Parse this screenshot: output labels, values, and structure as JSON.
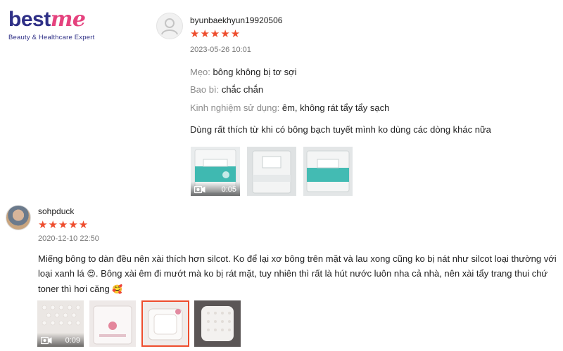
{
  "logo": {
    "word_best": "best",
    "word_me": "me",
    "tagline": "Beauty & Healthcare Expert"
  },
  "reviews": [
    {
      "username": "byunbaekhyun19920506",
      "stars": "★★★★★",
      "rating": 5,
      "datetime": "2023-05-26 10:01",
      "attrs": [
        {
          "label": "Mẹo:",
          "value": "bông không bị tơ sợi"
        },
        {
          "label": "Bao bì:",
          "value": "chắc chắn"
        },
        {
          "label": "Kinh nghiệm sử dụng:",
          "value": "êm, không rát tẩy tẩy sạch"
        }
      ],
      "comment": "Dùng rất thích từ khi có bông bạch tuyết mình ko dùng các dòng khác nữa",
      "video_duration": "0:05"
    },
    {
      "username": "sohpduck",
      "stars": "★★★★★",
      "rating": 5,
      "datetime": "2020-12-10 22:50",
      "comment_part1": "Miếng bông to dàn đều nên xài thích hơn silcot. Ko để lại xơ bông trên mặt và lau xong cũng ko bị nát như silcot loại thường với loại xanh lá",
      "emoji1": "😍",
      "comment_part2": ". Bông xài êm đi mướt mà ko bị rát mặt, tuy nhiên thì rất là hút nước luôn nha cả nhà, nên xài tẩy trang thui chứ toner thì hơi căng",
      "emoji2": "🥰",
      "video_duration": "0:09"
    }
  ],
  "colors": {
    "accent": "#ee4d2d",
    "brand_blue": "#2e2f86",
    "brand_pink": "#e5427e"
  }
}
